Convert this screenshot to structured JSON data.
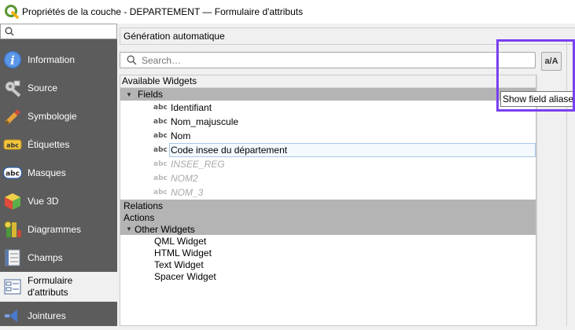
{
  "window": {
    "title": "Propriétés de la couche - DEPARTEMENT — Formulaire d'attributs"
  },
  "sidebar": {
    "search_placeholder": "",
    "items": [
      {
        "label": "Information",
        "icon": "info-icon"
      },
      {
        "label": "Source",
        "icon": "source-icon"
      },
      {
        "label": "Symbologie",
        "icon": "symbology-icon"
      },
      {
        "label": "Étiquettes",
        "icon": "labels-icon"
      },
      {
        "label": "Masques",
        "icon": "masks-icon"
      },
      {
        "label": "Vue 3D",
        "icon": "3d-view-icon"
      },
      {
        "label": "Diagrammes",
        "icon": "diagrams-icon"
      },
      {
        "label": "Champs",
        "icon": "fields-icon"
      },
      {
        "label_line1": "Formulaire",
        "label_line2": "d'attributs",
        "icon": "attributes-form-icon"
      },
      {
        "label": "Jointures",
        "icon": "joins-icon"
      }
    ]
  },
  "main": {
    "generation_mode": "Génération automatique",
    "search_placeholder": "Search…",
    "alias_button_label": "a/A",
    "tooltip": "Show field aliases",
    "tree_header": "Available Widgets",
    "fields_group": "Fields",
    "fields": [
      {
        "type": "abc",
        "name": "Identifiant"
      },
      {
        "type": "abc",
        "name": "Nom_majuscule"
      },
      {
        "type": "abc",
        "name": "Nom"
      },
      {
        "type": "abc",
        "name": "Code insee du département"
      },
      {
        "type": "abc",
        "name": "INSEE_REG"
      },
      {
        "type": "abc",
        "name": "NOM2"
      },
      {
        "type": "abc",
        "name": "NOM_3"
      }
    ],
    "relations_group": "Relations",
    "actions_group": "Actions",
    "other_group": "Other Widgets",
    "other_widgets": [
      "QML Widget",
      "HTML Widget",
      "Text Widget",
      "Spacer Widget"
    ]
  },
  "colors": {
    "sidebar_bg": "#5c5c5c",
    "group_bg": "#b4b4b4",
    "highlight": "#7a3ff0"
  }
}
